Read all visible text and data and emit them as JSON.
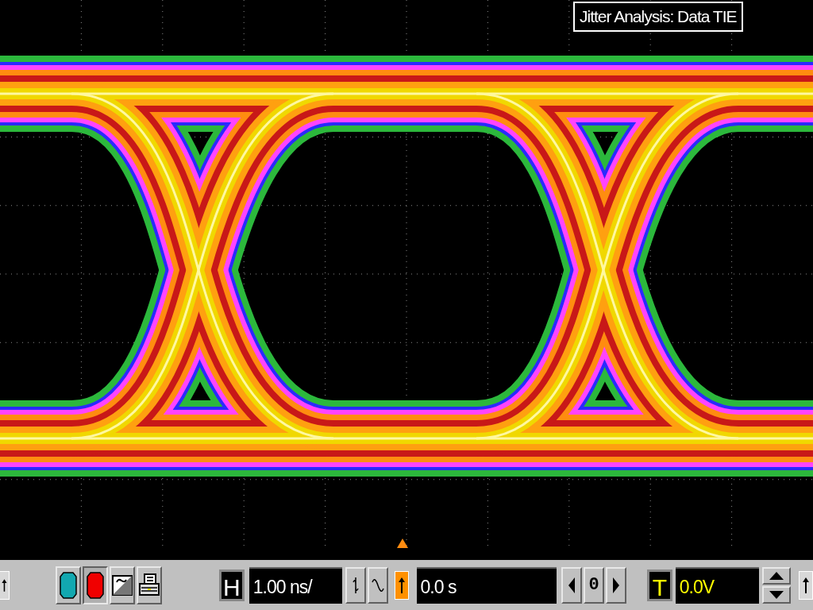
{
  "display": {
    "label": "Jitter Analysis: Data TIE"
  },
  "toolbar": {
    "run_controls": [
      {
        "kind": "run",
        "selected": false
      },
      {
        "kind": "stop",
        "selected": true
      }
    ],
    "horizontal": {
      "label": "H",
      "scale": "1.00 ns/"
    },
    "delay": {
      "value": "0.0 s",
      "zero_button": "0"
    },
    "trigger": {
      "label": "T",
      "trigger_level": "0.0V"
    }
  }
}
